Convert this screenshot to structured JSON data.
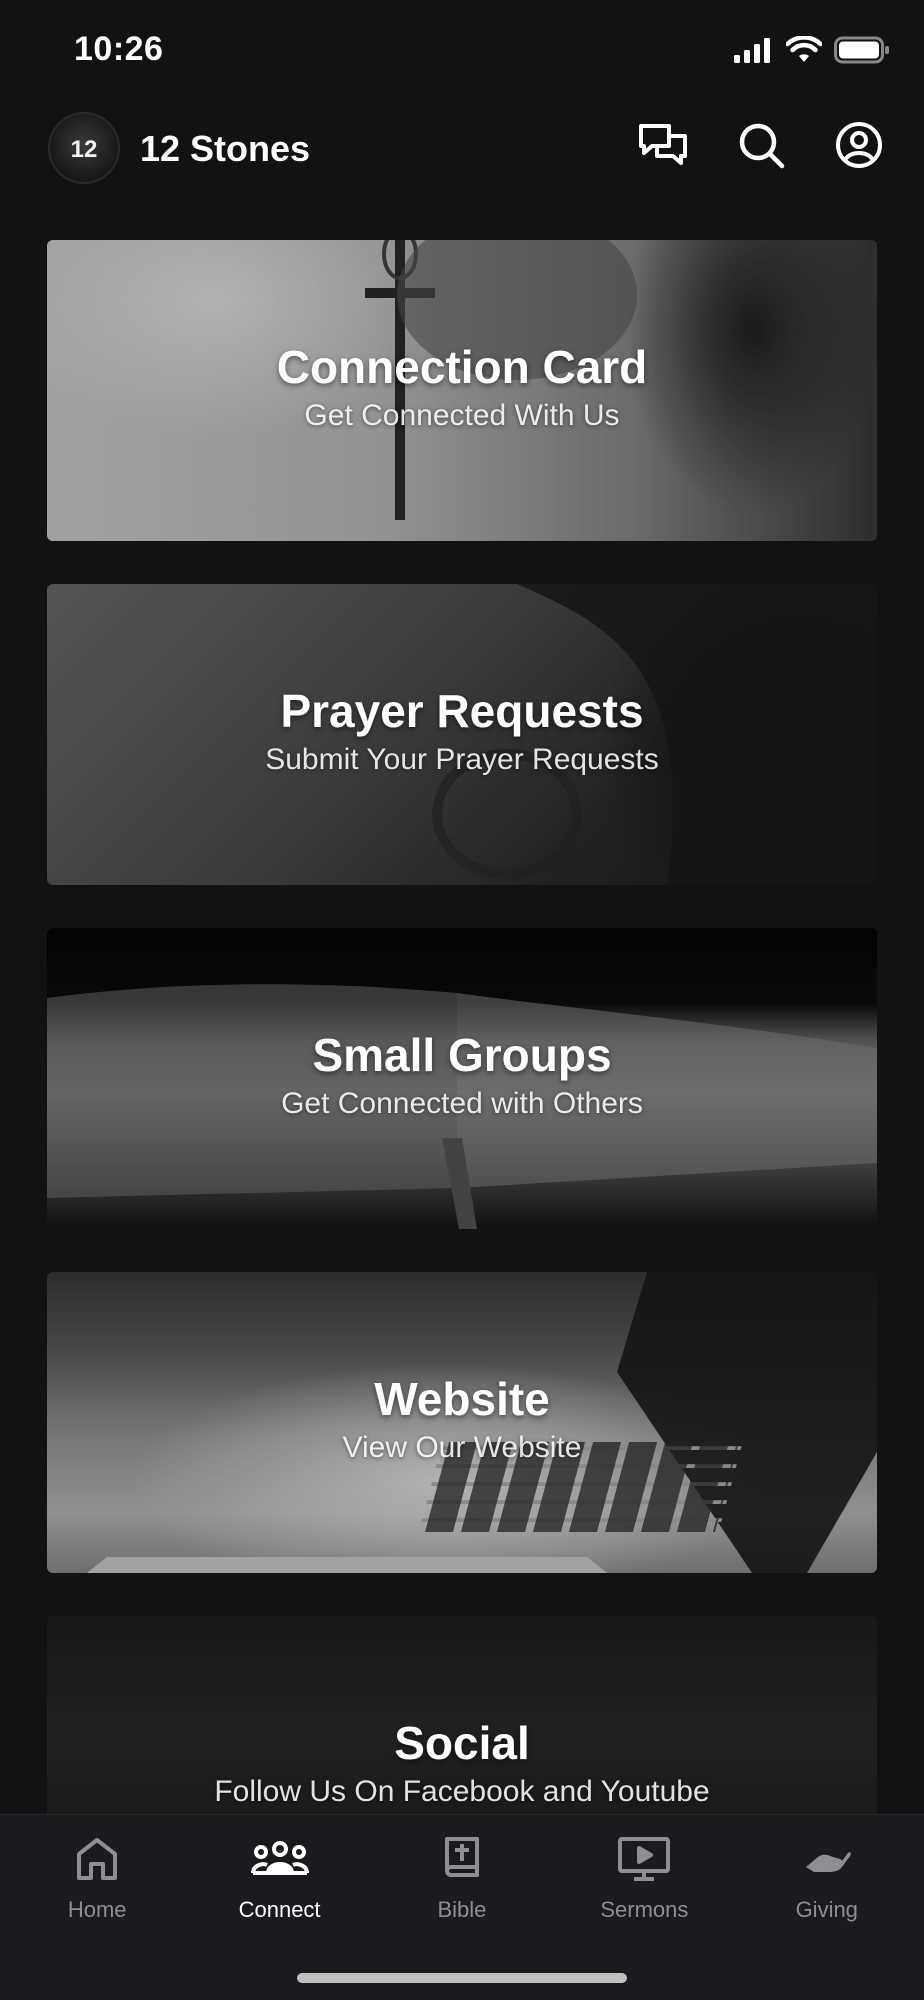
{
  "status_bar": {
    "time": "10:26"
  },
  "header": {
    "logo_text": "12",
    "title": "12 Stones",
    "actions": [
      "messages-icon",
      "search-icon",
      "profile-icon"
    ]
  },
  "cards": [
    {
      "title": "Connection Card",
      "subtitle": "Get Connected With Us"
    },
    {
      "title": "Prayer Requests",
      "subtitle": "Submit Your Prayer Requests"
    },
    {
      "title": "Small Groups",
      "subtitle": "Get Connected with Others"
    },
    {
      "title": "Website",
      "subtitle": "View Our Website"
    },
    {
      "title": "Social",
      "subtitle": "Follow Us On Facebook and Youtube"
    }
  ],
  "tabs": [
    {
      "label": "Home",
      "icon": "home-icon",
      "active": false
    },
    {
      "label": "Connect",
      "icon": "people-icon",
      "active": true
    },
    {
      "label": "Bible",
      "icon": "bible-icon",
      "active": false
    },
    {
      "label": "Sermons",
      "icon": "play-screen-icon",
      "active": false
    },
    {
      "label": "Giving",
      "icon": "giving-hand-icon",
      "active": false
    }
  ],
  "colors": {
    "background": "#111214",
    "tab_bar": "#1a1b1e",
    "tab_active": "#ffffff",
    "tab_inactive": "#8d8f94"
  }
}
